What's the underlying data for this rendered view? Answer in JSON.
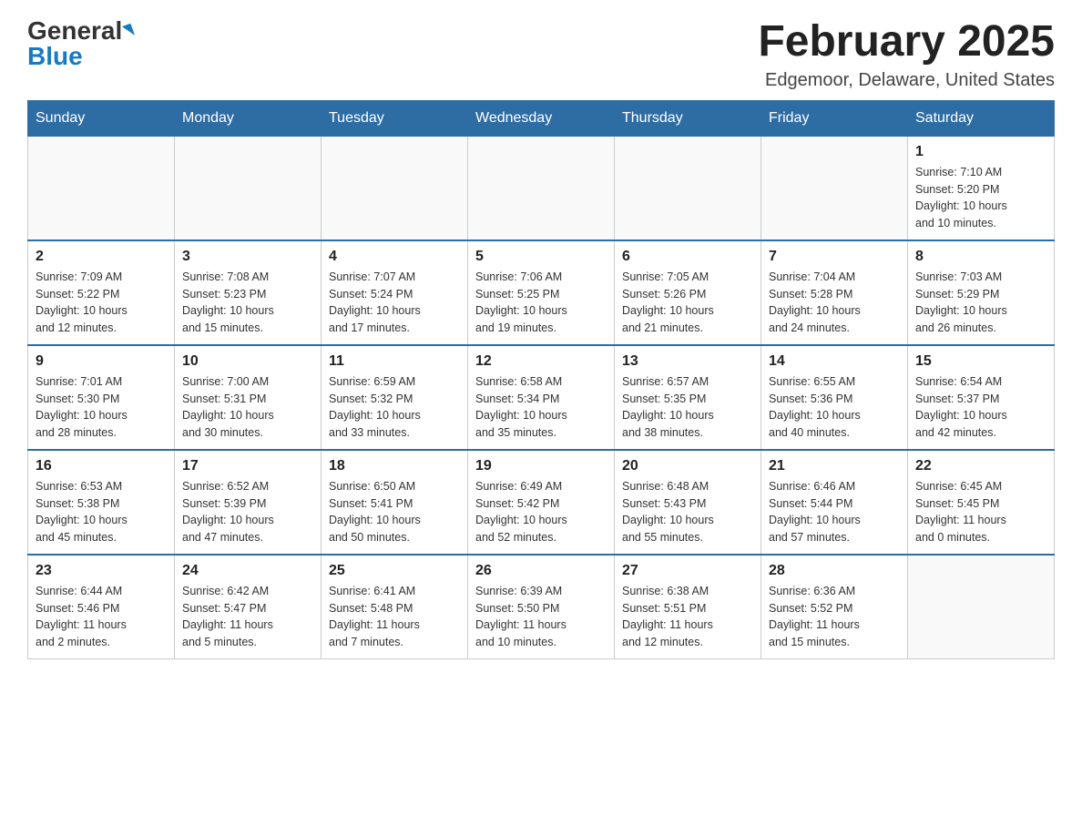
{
  "logo": {
    "general": "General",
    "blue": "Blue"
  },
  "title": "February 2025",
  "location": "Edgemoor, Delaware, United States",
  "days_of_week": [
    "Sunday",
    "Monday",
    "Tuesday",
    "Wednesday",
    "Thursday",
    "Friday",
    "Saturday"
  ],
  "weeks": [
    [
      {
        "day": "",
        "info": ""
      },
      {
        "day": "",
        "info": ""
      },
      {
        "day": "",
        "info": ""
      },
      {
        "day": "",
        "info": ""
      },
      {
        "day": "",
        "info": ""
      },
      {
        "day": "",
        "info": ""
      },
      {
        "day": "1",
        "info": "Sunrise: 7:10 AM\nSunset: 5:20 PM\nDaylight: 10 hours\nand 10 minutes."
      }
    ],
    [
      {
        "day": "2",
        "info": "Sunrise: 7:09 AM\nSunset: 5:22 PM\nDaylight: 10 hours\nand 12 minutes."
      },
      {
        "day": "3",
        "info": "Sunrise: 7:08 AM\nSunset: 5:23 PM\nDaylight: 10 hours\nand 15 minutes."
      },
      {
        "day": "4",
        "info": "Sunrise: 7:07 AM\nSunset: 5:24 PM\nDaylight: 10 hours\nand 17 minutes."
      },
      {
        "day": "5",
        "info": "Sunrise: 7:06 AM\nSunset: 5:25 PM\nDaylight: 10 hours\nand 19 minutes."
      },
      {
        "day": "6",
        "info": "Sunrise: 7:05 AM\nSunset: 5:26 PM\nDaylight: 10 hours\nand 21 minutes."
      },
      {
        "day": "7",
        "info": "Sunrise: 7:04 AM\nSunset: 5:28 PM\nDaylight: 10 hours\nand 24 minutes."
      },
      {
        "day": "8",
        "info": "Sunrise: 7:03 AM\nSunset: 5:29 PM\nDaylight: 10 hours\nand 26 minutes."
      }
    ],
    [
      {
        "day": "9",
        "info": "Sunrise: 7:01 AM\nSunset: 5:30 PM\nDaylight: 10 hours\nand 28 minutes."
      },
      {
        "day": "10",
        "info": "Sunrise: 7:00 AM\nSunset: 5:31 PM\nDaylight: 10 hours\nand 30 minutes."
      },
      {
        "day": "11",
        "info": "Sunrise: 6:59 AM\nSunset: 5:32 PM\nDaylight: 10 hours\nand 33 minutes."
      },
      {
        "day": "12",
        "info": "Sunrise: 6:58 AM\nSunset: 5:34 PM\nDaylight: 10 hours\nand 35 minutes."
      },
      {
        "day": "13",
        "info": "Sunrise: 6:57 AM\nSunset: 5:35 PM\nDaylight: 10 hours\nand 38 minutes."
      },
      {
        "day": "14",
        "info": "Sunrise: 6:55 AM\nSunset: 5:36 PM\nDaylight: 10 hours\nand 40 minutes."
      },
      {
        "day": "15",
        "info": "Sunrise: 6:54 AM\nSunset: 5:37 PM\nDaylight: 10 hours\nand 42 minutes."
      }
    ],
    [
      {
        "day": "16",
        "info": "Sunrise: 6:53 AM\nSunset: 5:38 PM\nDaylight: 10 hours\nand 45 minutes."
      },
      {
        "day": "17",
        "info": "Sunrise: 6:52 AM\nSunset: 5:39 PM\nDaylight: 10 hours\nand 47 minutes."
      },
      {
        "day": "18",
        "info": "Sunrise: 6:50 AM\nSunset: 5:41 PM\nDaylight: 10 hours\nand 50 minutes."
      },
      {
        "day": "19",
        "info": "Sunrise: 6:49 AM\nSunset: 5:42 PM\nDaylight: 10 hours\nand 52 minutes."
      },
      {
        "day": "20",
        "info": "Sunrise: 6:48 AM\nSunset: 5:43 PM\nDaylight: 10 hours\nand 55 minutes."
      },
      {
        "day": "21",
        "info": "Sunrise: 6:46 AM\nSunset: 5:44 PM\nDaylight: 10 hours\nand 57 minutes."
      },
      {
        "day": "22",
        "info": "Sunrise: 6:45 AM\nSunset: 5:45 PM\nDaylight: 11 hours\nand 0 minutes."
      }
    ],
    [
      {
        "day": "23",
        "info": "Sunrise: 6:44 AM\nSunset: 5:46 PM\nDaylight: 11 hours\nand 2 minutes."
      },
      {
        "day": "24",
        "info": "Sunrise: 6:42 AM\nSunset: 5:47 PM\nDaylight: 11 hours\nand 5 minutes."
      },
      {
        "day": "25",
        "info": "Sunrise: 6:41 AM\nSunset: 5:48 PM\nDaylight: 11 hours\nand 7 minutes."
      },
      {
        "day": "26",
        "info": "Sunrise: 6:39 AM\nSunset: 5:50 PM\nDaylight: 11 hours\nand 10 minutes."
      },
      {
        "day": "27",
        "info": "Sunrise: 6:38 AM\nSunset: 5:51 PM\nDaylight: 11 hours\nand 12 minutes."
      },
      {
        "day": "28",
        "info": "Sunrise: 6:36 AM\nSunset: 5:52 PM\nDaylight: 11 hours\nand 15 minutes."
      },
      {
        "day": "",
        "info": ""
      }
    ]
  ]
}
